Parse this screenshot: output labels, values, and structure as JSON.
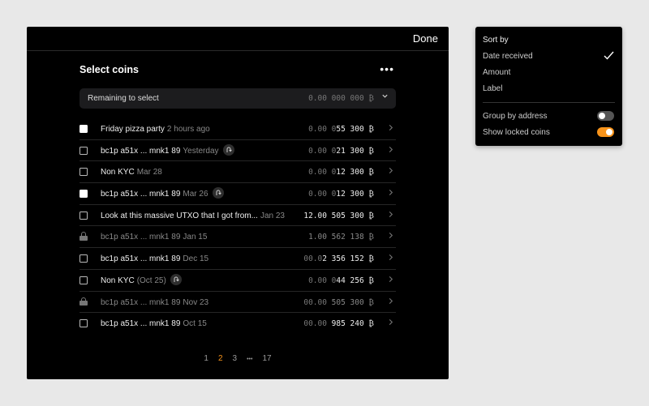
{
  "header": {
    "done_label": "Done"
  },
  "panel": {
    "title": "Select coins",
    "more_icon": "ellipsis-icon",
    "remaining_label": "Remaining to select",
    "remaining_amount_dim": "0.00 000 000 ₿",
    "remaining_amount": ""
  },
  "coins": [
    {
      "state": "checked",
      "name": "Friday pizza party",
      "date": "2 hours ago",
      "badge": false,
      "amount_dim": "0.00 0",
      "amount": "55 300 ₿"
    },
    {
      "state": "unchecked",
      "name": "bc1p a51x ... mnk1 89",
      "date": "Yesterday",
      "badge": true,
      "amount_dim": "0.00 0",
      "amount": "21 300 ₿"
    },
    {
      "state": "unchecked",
      "name": "Non KYC",
      "date": "Mar 28",
      "badge": false,
      "amount_dim": "0.00 0",
      "amount": "12 300 ₿"
    },
    {
      "state": "checked",
      "name": "bc1p a51x ... mnk1 89",
      "date": "Mar 26",
      "badge": true,
      "amount_dim": "0.00 0",
      "amount": "12 300 ₿"
    },
    {
      "state": "unchecked",
      "name": "Look at this massive UTXO that I got from...",
      "date": "Jan 23",
      "badge": false,
      "amount_dim": "",
      "amount": "12.00 505 300 ₿"
    },
    {
      "state": "locked",
      "name": "bc1p a51x ... mnk1 89",
      "date": "Jan 15",
      "badge": false,
      "amount_dim": "",
      "amount": "1.00 562 138 ₿"
    },
    {
      "state": "unchecked",
      "name": "bc1p a51x ... mnk1 89",
      "date": "Dec 15",
      "badge": false,
      "amount_dim": "00.0",
      "amount": "2 356 152 ₿"
    },
    {
      "state": "unchecked",
      "name": "Non KYC",
      "date": "(Oct 25)",
      "badge": true,
      "amount_dim": "0.00 0",
      "amount": "44 256 ₿"
    },
    {
      "state": "locked",
      "name": "bc1p a51x ... mnk1 89",
      "date": "Nov 23",
      "badge": false,
      "amount_dim": "00.00",
      "amount": " 505 300 ₿"
    },
    {
      "state": "unchecked",
      "name": "bc1p a51x ... mnk1 89",
      "date": "Oct 15",
      "badge": false,
      "amount_dim": "00.00",
      "amount": " 985 240 ₿"
    }
  ],
  "pagination": {
    "pages": [
      "1",
      "2",
      "3"
    ],
    "ellipsis": "•••",
    "last": "17",
    "active": "2"
  },
  "popover": {
    "sort_by_label": "Sort by",
    "options": [
      "Date received",
      "Amount",
      "Label"
    ],
    "selected": "Date received",
    "group_by_address_label": "Group by address",
    "group_by_address_on": false,
    "show_locked_label": "Show locked coins",
    "show_locked_on": true
  },
  "colors": {
    "accent": "#f7931a",
    "background": "#000000",
    "page": "#e8e8e8"
  }
}
